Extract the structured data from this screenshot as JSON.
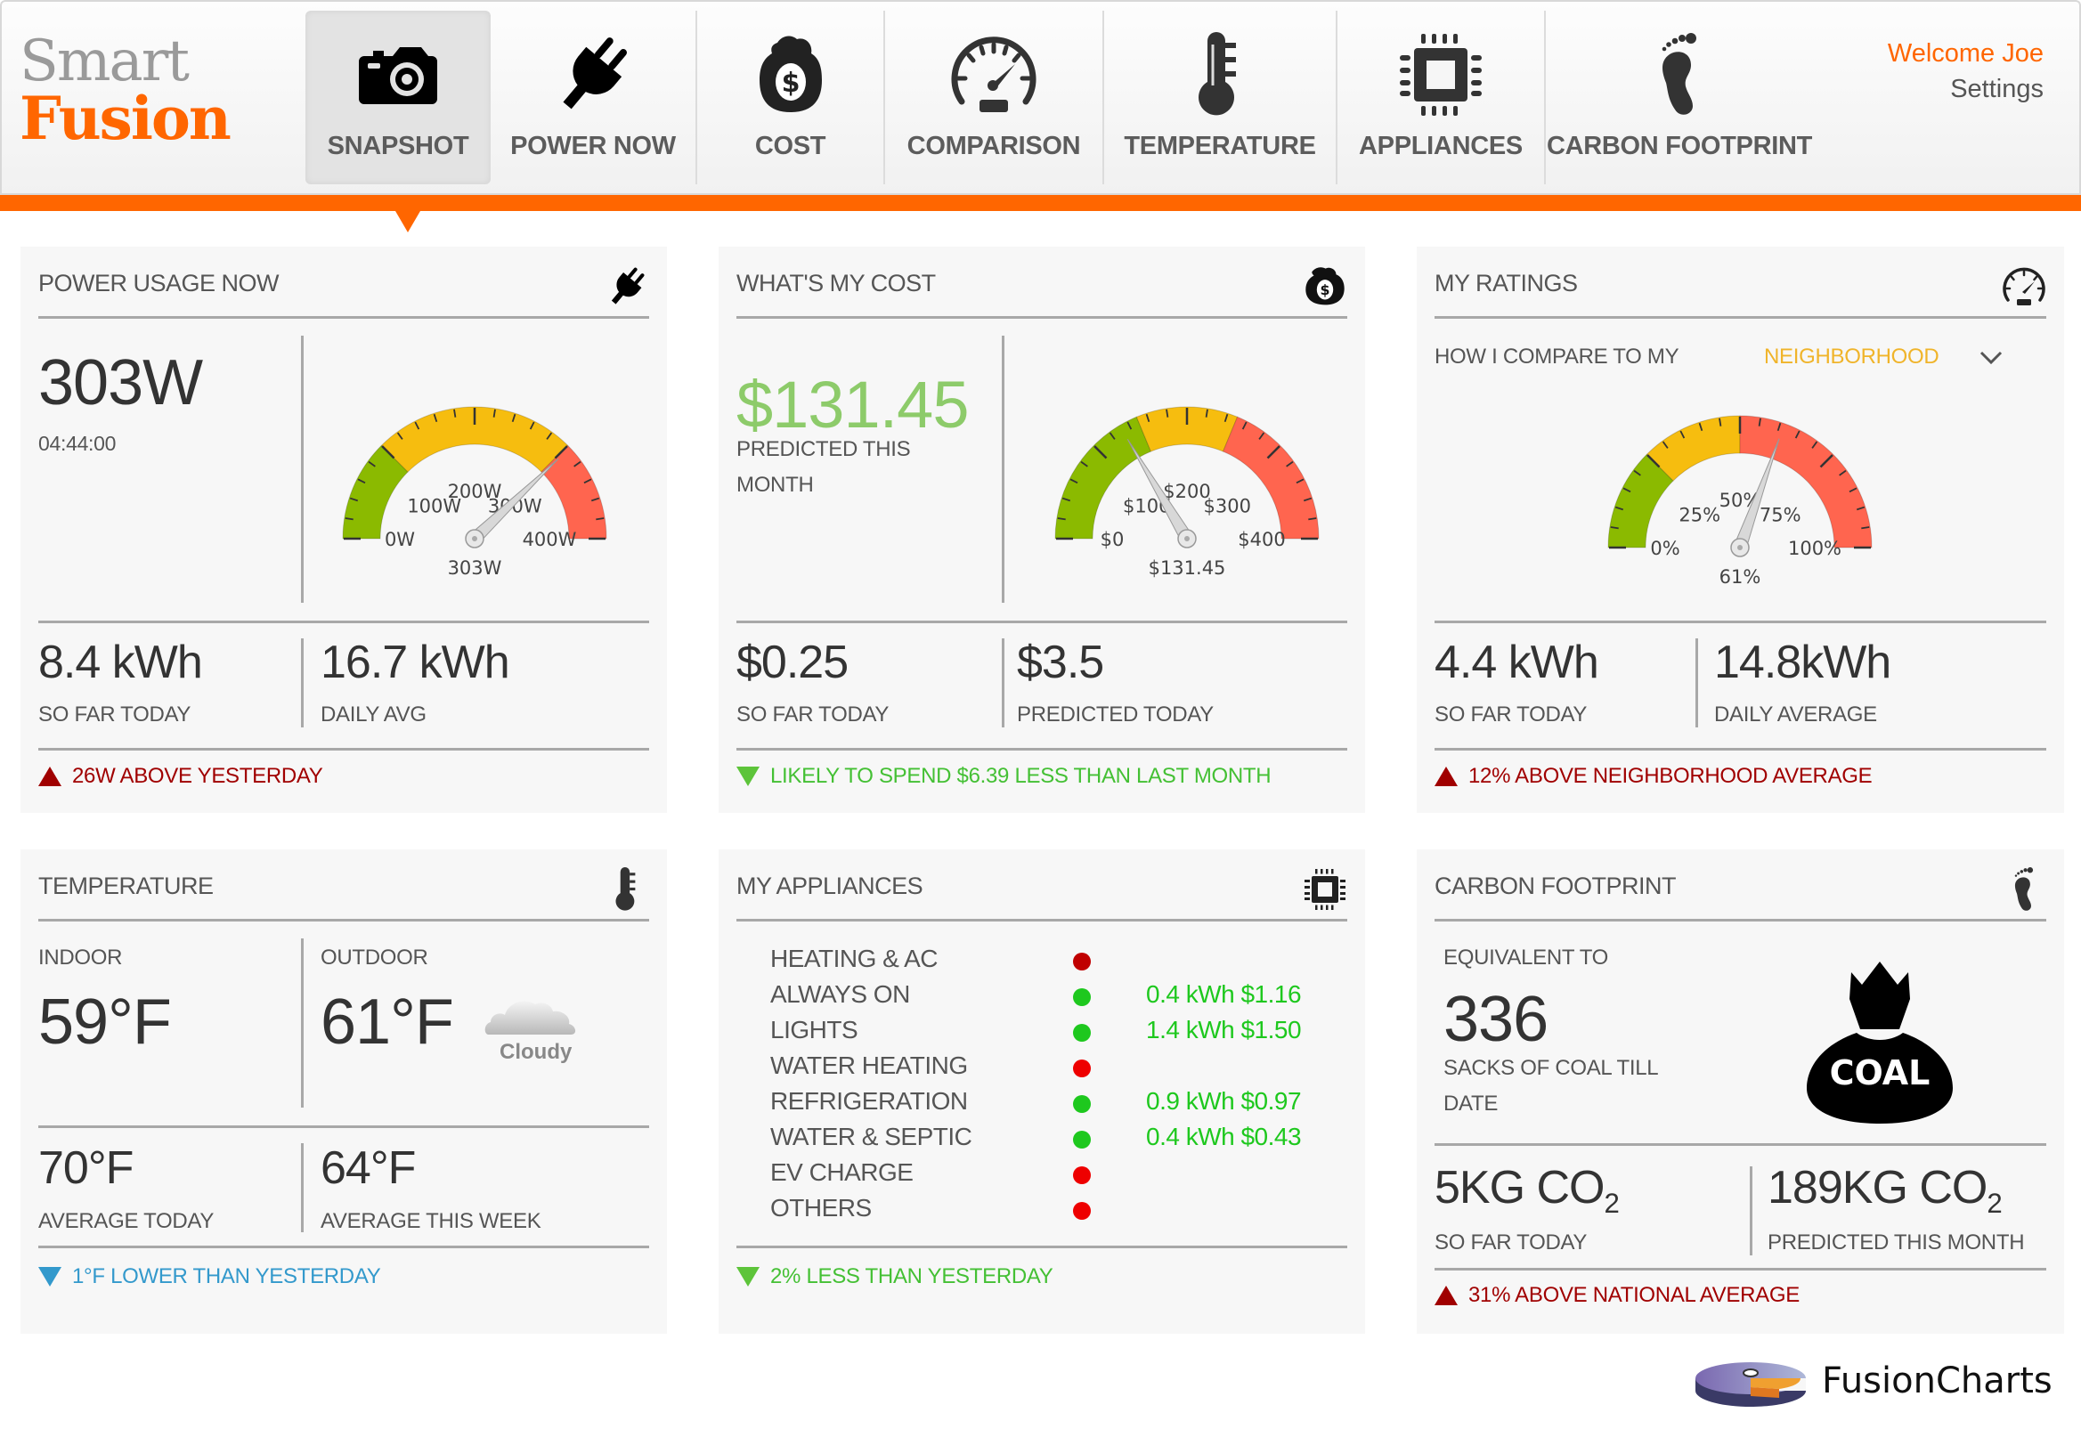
{
  "header": {
    "logo_line1": "Smart",
    "logo_line2": "Fusion",
    "nav": [
      {
        "label": "SNAPSHOT",
        "icon": "camera-icon",
        "active": true
      },
      {
        "label": "POWER NOW",
        "icon": "plug-icon",
        "active": false
      },
      {
        "label": "COST",
        "icon": "money-bag-icon",
        "active": false
      },
      {
        "label": "COMPARISON",
        "icon": "speedometer-icon",
        "active": false
      },
      {
        "label": "TEMPERATURE",
        "icon": "thermometer-icon",
        "active": false
      },
      {
        "label": "APPLIANCES",
        "icon": "chip-icon",
        "active": false
      },
      {
        "label": "CARBON FOOTPRINT",
        "icon": "footprint-icon",
        "active": false
      }
    ],
    "welcome": "Welcome Joe",
    "settings": "Settings"
  },
  "colors": {
    "brand_orange": "#ff6600",
    "gauge_green": "#8bba00",
    "gauge_yellow": "#f6bd0f",
    "gauge_red": "#ff654f",
    "alert_red": "#a00000",
    "good_green": "#44c034",
    "info_blue": "#3399cc",
    "cost_green": "#8dcb6a",
    "neighborhood_yellow": "#f0b42a"
  },
  "power": {
    "title": "POWER USAGE NOW",
    "icon": "plug-icon",
    "current": "303W",
    "time": "04:44:00",
    "so_far_value": "8.4 kWh",
    "so_far_label": "SO FAR TODAY",
    "daily_avg_value": "16.7 kWh",
    "daily_avg_label": "DAILY AVG",
    "status": "26W ABOVE YESTERDAY",
    "status_direction": "up"
  },
  "cost": {
    "title": "WHAT'S MY COST",
    "icon": "money-bag-icon",
    "predicted": "$131.45",
    "predicted_label_1": "PREDICTED THIS",
    "predicted_label_2": "MONTH",
    "so_far_value": "$0.25",
    "so_far_label": "SO FAR TODAY",
    "predicted_today_value": "$3.5",
    "predicted_today_label": "PREDICTED TODAY",
    "status": "LIKELY TO SPEND $6.39 LESS THAN LAST MONTH",
    "status_direction": "down"
  },
  "ratings": {
    "title": "MY RATINGS",
    "icon": "speedometer-icon",
    "compare_label": "HOW I COMPARE TO MY",
    "compare_select": "NEIGHBORHOOD",
    "so_far_value": "4.4 kWh",
    "so_far_label": "SO FAR TODAY",
    "daily_avg_value": "14.8kWh",
    "daily_avg_label": "DAILY AVERAGE",
    "status": "12% ABOVE NEIGHBORHOOD AVERAGE",
    "status_direction": "up"
  },
  "temperature": {
    "title": "TEMPERATURE",
    "icon": "thermometer-icon",
    "indoor_label": "INDOOR",
    "indoor_value": "59°F",
    "outdoor_label": "OUTDOOR",
    "outdoor_value": "61°F",
    "weather": "Cloudy",
    "avg_today_value": "70°F",
    "avg_today_label": "AVERAGE TODAY",
    "avg_week_value": "64°F",
    "avg_week_label": "AVERAGE THIS WEEK",
    "status": "1°F LOWER THAN YESTERDAY",
    "status_direction": "down"
  },
  "appliances": {
    "title": "MY APPLIANCES",
    "icon": "chip-icon",
    "items": [
      {
        "name": "HEATING & AC",
        "status": "off",
        "color": "#c00000",
        "value": ""
      },
      {
        "name": "ALWAYS ON",
        "status": "on",
        "color": "#1ec81e",
        "value": "0.4 kWh $1.16"
      },
      {
        "name": "LIGHTS",
        "status": "on",
        "color": "#1ec81e",
        "value": "1.4 kWh $1.50"
      },
      {
        "name": "WATER HEATING",
        "status": "off",
        "color": "#ee0000",
        "value": ""
      },
      {
        "name": "REFRIGERATION",
        "status": "on",
        "color": "#1ec81e",
        "value": "0.9 kWh $0.97"
      },
      {
        "name": "WATER & SEPTIC",
        "status": "on",
        "color": "#1ec81e",
        "value": "0.4 kWh $0.43"
      },
      {
        "name": "EV CHARGE",
        "status": "off",
        "color": "#ee0000",
        "value": ""
      },
      {
        "name": "OTHERS",
        "status": "off",
        "color": "#ee0000",
        "value": ""
      }
    ],
    "status": "2% LESS THAN YESTERDAY",
    "status_direction": "down"
  },
  "carbon": {
    "title": "CARBON FOOTPRINT",
    "icon": "footprint-icon",
    "equivalent_label": "EQUIVALENT TO",
    "sacks_value": "336",
    "sacks_label_1": "SACKS OF COAL TILL",
    "sacks_label_2": "DATE",
    "coal_bag_text": "COAL",
    "so_far_value": "5KG CO",
    "so_far_sub": "2",
    "so_far_label": "SO FAR TODAY",
    "predicted_value": "189KG CO",
    "predicted_sub": "2",
    "predicted_label": "PREDICTED THIS MONTH",
    "status": "31% ABOVE NATIONAL AVERAGE",
    "status_direction": "up"
  },
  "footer": {
    "brand": "FusionCharts"
  },
  "chart_data": [
    {
      "type": "gauge",
      "name": "power-gauge",
      "min": 0,
      "max": 400,
      "value": 303,
      "value_label": "303W",
      "tick_labels": [
        "0W",
        "100W",
        "200W",
        "300W",
        "400W"
      ],
      "bands": [
        {
          "from": 0,
          "to": 100,
          "color": "#8bba00"
        },
        {
          "from": 100,
          "to": 300,
          "color": "#f6bd0f"
        },
        {
          "from": 300,
          "to": 400,
          "color": "#ff654f"
        }
      ]
    },
    {
      "type": "gauge",
      "name": "cost-gauge",
      "min": 0,
      "max": 400,
      "value": 131.45,
      "value_label": "$131.45",
      "tick_labels": [
        "$0",
        "$100",
        "$200",
        "$300",
        "$400"
      ],
      "bands": [
        {
          "from": 0,
          "to": 150,
          "color": "#8bba00"
        },
        {
          "from": 150,
          "to": 250,
          "color": "#f6bd0f"
        },
        {
          "from": 250,
          "to": 400,
          "color": "#ff654f"
        }
      ]
    },
    {
      "type": "gauge",
      "name": "ratings-gauge",
      "min": 0,
      "max": 100,
      "value": 61,
      "value_label": "61%",
      "tick_labels": [
        "0%",
        "25%",
        "50%",
        "75%",
        "100%"
      ],
      "bands": [
        {
          "from": 0,
          "to": 25,
          "color": "#8bba00"
        },
        {
          "from": 25,
          "to": 50,
          "color": "#f6bd0f"
        },
        {
          "from": 50,
          "to": 100,
          "color": "#ff654f"
        }
      ]
    }
  ]
}
